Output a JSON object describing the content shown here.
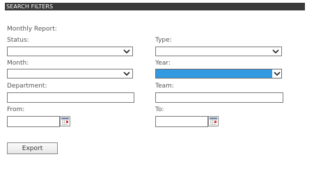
{
  "panel": {
    "title": "SEARCH FILTERS"
  },
  "report": {
    "label": "Monthly Report:"
  },
  "status": {
    "label": "Status:",
    "value": ""
  },
  "type": {
    "label": "Type:",
    "value": ""
  },
  "month": {
    "label": "Month:",
    "value": ""
  },
  "year": {
    "label": "Year:",
    "value": "",
    "highlight_color": "#3399e0"
  },
  "department": {
    "label": "Department:",
    "value": ""
  },
  "team": {
    "label": "Team:",
    "value": ""
  },
  "from": {
    "label": "From:",
    "value": ""
  },
  "to": {
    "label": "To:",
    "value": ""
  },
  "actions": {
    "export_label": "Export"
  },
  "icons": {
    "dropdown": "chevron-down-icon",
    "date_picker": "calendar-icon"
  }
}
